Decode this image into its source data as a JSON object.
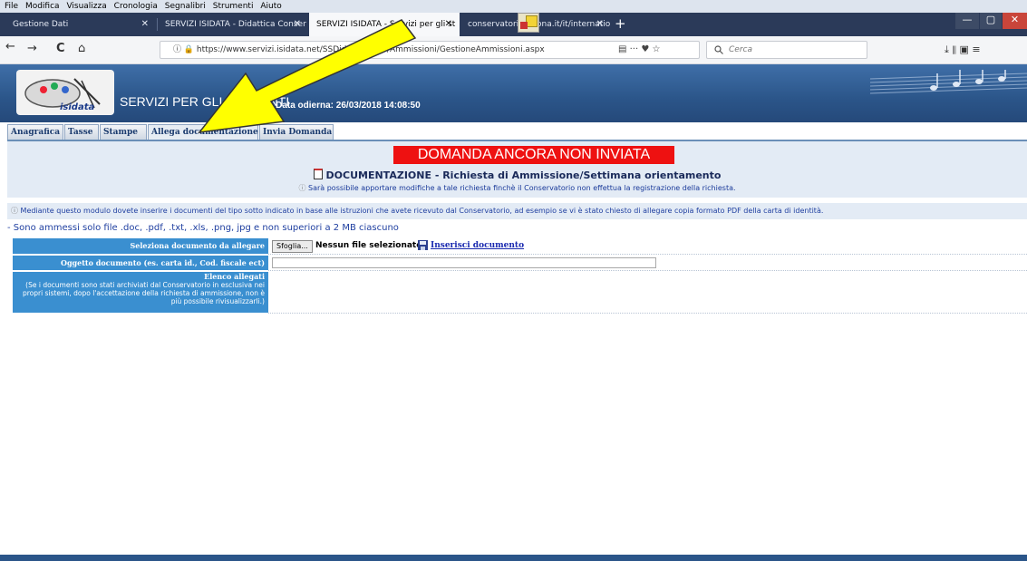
{
  "menubar": {
    "items": [
      "File",
      "Modifica",
      "Visualizza",
      "Cronologia",
      "Segnalibri",
      "Strumenti",
      "Aiuto"
    ]
  },
  "browser_tabs": [
    {
      "label": "Gestione Dati",
      "active": false
    },
    {
      "label": "SERVIZI ISIDATA - Didattica Conser",
      "active": false
    },
    {
      "label": "SERVIZI ISIDATA - Servizi per gli st",
      "active": true
    },
    {
      "label": "conservatorioverona.it/it/internatio",
      "active": false
    }
  ],
  "close_glyph": "✕",
  "new_tab_glyph": "+",
  "window_controls": [
    "—",
    "▢",
    "✕"
  ],
  "nav": {
    "back": "←",
    "forward": "→",
    "reload": "C",
    "home": "⌂",
    "url": "ⓘ 🔒 https://www.servizi.isidata.net/SSDidatticheCO/Ammissioni/GestioneAmmissioni.aspx",
    "page_actions": "▤   ···  ♥  ☆",
    "search_placeholder": "Cerca",
    "right_icons": "⤓   ⫴   ▣   ≡"
  },
  "app": {
    "logo_text": "isidata",
    "title": "SERVIZI PER GLI STUDENTI",
    "date_line": " - Data odierna: 26/03/2018 14:08:50"
  },
  "app_tabs": [
    "Anagrafica",
    "Tasse",
    "Stampe",
    "Allega documentazione",
    "Invia Domanda"
  ],
  "content": {
    "status_badge": "DOMANDA ANCORA NON INVIATA",
    "doc_title": "DOCUMENTAZIONE - Richiesta di Ammissione/Settimana orientamento",
    "doc_note": "Sarà possibile apportare modifiche a tale richiesta finchè il Conservatorio non effettua la registrazione della richiesta.",
    "instructions": "Mediante questo modulo dovete inserire i documenti del tipo sotto indicato in base alle istruzioni che avete ricevuto dal Conservatorio, ad esempio se vi è stato chiesto di allegare copia formato PDF della carta di identità.",
    "allowed_files": "- Sono ammessi solo file .doc, .pdf, .txt, .xls, .png, jpg e non superiori a 2 MB ciascuno",
    "select_label": "Seleziona documento da allegare",
    "browse_button": "Sfoglia...",
    "no_file": "Nessun file selezionato.",
    "insert_link": "Inserisci documento",
    "object_label": "Oggetto documento (es. carta id., Cod. fiscale ect)",
    "list_label": "Elenco allegati",
    "list_note": "(Se i documenti sono stati archiviati dal Conservatorio in esclusiva nei propri sistemi, dopo l'accettazione della richiesta di ammissione, non è più possibile rivisualizzarli.)"
  },
  "colors": {
    "accent": "#3a8fd0",
    "status": "#ee1111",
    "header": "#2b5589",
    "arrow": "#ffff00"
  }
}
